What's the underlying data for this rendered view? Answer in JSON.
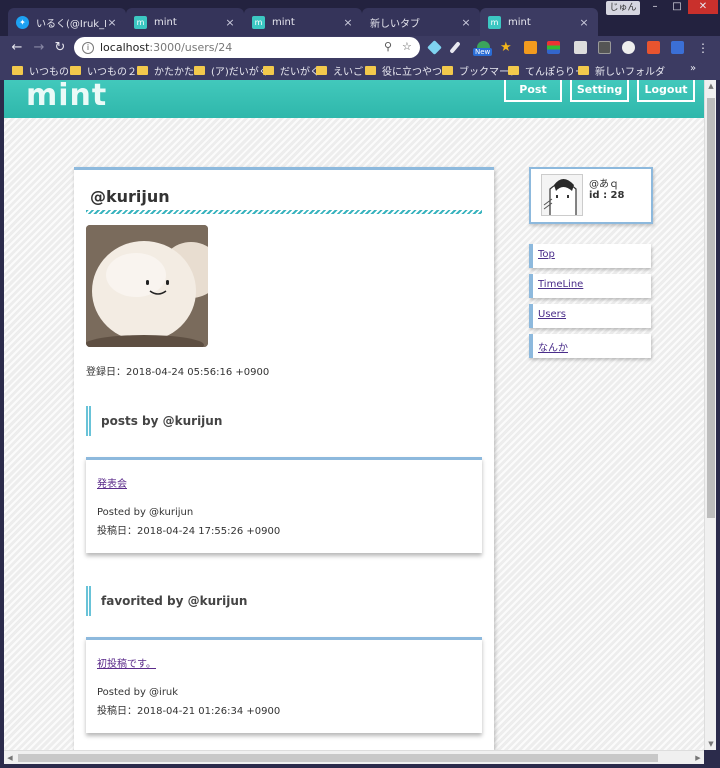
{
  "browser": {
    "tabs": [
      {
        "label": "いるく(@Iruk_Nuj)さん",
        "icon": "twitter-icon"
      },
      {
        "label": "mint",
        "icon": "mint-favicon"
      },
      {
        "label": "mint",
        "icon": "mint-favicon"
      },
      {
        "label": "新しいタブ",
        "icon": ""
      },
      {
        "label": "mint",
        "icon": "mint-favicon"
      }
    ],
    "user_chip": "じゅん",
    "url_host": "localhost",
    "url_path": ":3000/users/24",
    "extension_badge": "New",
    "bookmarks": [
      "いつもの",
      "いつもの２",
      "かたかた",
      "(ア)だいがく",
      "だいがく",
      "えいご",
      "役に立つやつ",
      "ブックマーク",
      "てんぽらりー",
      "新しいフォルダ"
    ],
    "bookmarks_overflow": "»"
  },
  "header": {
    "logo": "mint",
    "post_label": "Post",
    "setting_label": "Setting",
    "logout_label": "Logout",
    "color": "#3cc1b5"
  },
  "profile": {
    "username": "@kurijun",
    "registered": "登録日：2018-04-24 05:56:16 +0900"
  },
  "posts_section": {
    "title": "posts by @kurijun",
    "items": [
      {
        "link": "発表会",
        "by": "Posted by @kurijun",
        "date": "投稿日：2018-04-24 17:55:26 +0900"
      }
    ]
  },
  "favorites_section": {
    "title": "favorited by @kurijun",
    "items": [
      {
        "link": "初投稿です。",
        "by": "Posted by @iruk",
        "date": "投稿日：2018-04-21 01:26:34 +0900"
      }
    ]
  },
  "current_user": {
    "handle": "@あｑ",
    "id": "id : 28"
  },
  "sidebar": {
    "items": [
      {
        "label": "Top"
      },
      {
        "label": "TimeLine"
      },
      {
        "label": "Users"
      },
      {
        "label": "なんか"
      }
    ]
  }
}
